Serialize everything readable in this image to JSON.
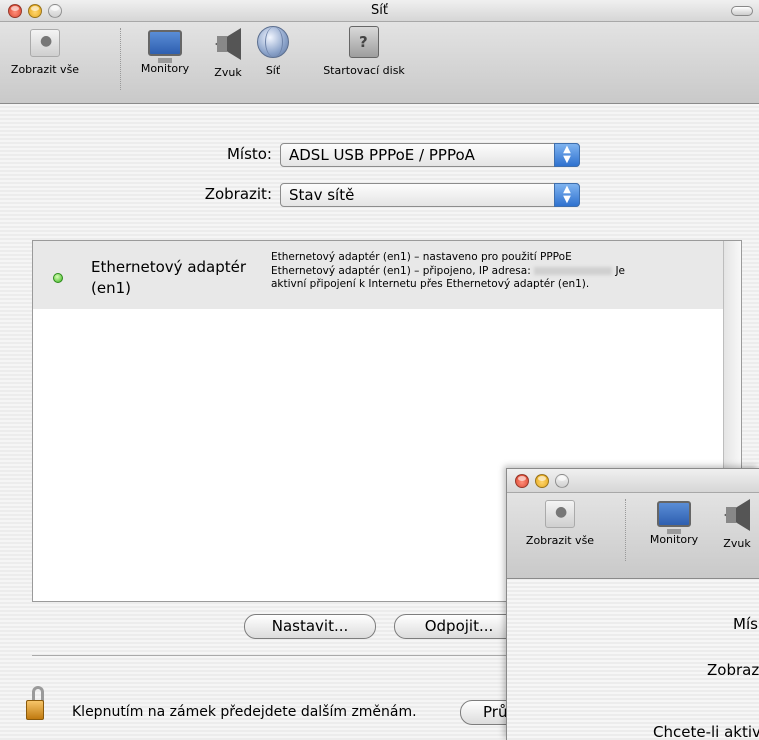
{
  "window": {
    "title": "Síť"
  },
  "toolbar": {
    "items": [
      {
        "label": "Zobrazit vše",
        "icon": "show-all-icon"
      },
      {
        "label": "Monitory",
        "icon": "monitor-icon"
      },
      {
        "label": "Zvuk",
        "icon": "speaker-icon"
      },
      {
        "label": "Síť",
        "icon": "network-globe-icon",
        "selected": true
      },
      {
        "label": "Startovací disk",
        "icon": "startup-disk-icon"
      }
    ]
  },
  "form": {
    "location_label": "Místo:",
    "location_value": "ADSL USB PPPoE / PPPoA",
    "show_label": "Zobrazit:",
    "show_value": "Stav sítě"
  },
  "list": {
    "rows": [
      {
        "name": "Ethernetový adaptér (en1)",
        "status": "connected",
        "line1": "Ethernetový adaptér (en1) – nastaveno pro použití PPPoE",
        "line2_start": "Ethernetový adaptér (en1) – připojeno, IP adresa:",
        "line2_end": "Je",
        "line3": "aktivní připojení k Internetu přes Ethernetový adaptér (en1)."
      }
    ]
  },
  "buttons": {
    "configure": "Nastavit...",
    "disconnect": "Odpojit...",
    "assist": "Prů"
  },
  "footer": {
    "lock_text": "Klepnutím na zámek předejdete dalším změnám."
  },
  "window2": {
    "toolbar": {
      "items": [
        {
          "label": "Zobrazit vše"
        },
        {
          "label": "Monitory"
        },
        {
          "label": "Zvuk"
        }
      ]
    },
    "location_label_partial": "Mís",
    "show_label_partial": "Zobraz",
    "bottom_text_partial": "Chcete-li aktiv"
  },
  "colors": {
    "status_green": "#3bb520",
    "popup_blue": "#2f71cf"
  }
}
